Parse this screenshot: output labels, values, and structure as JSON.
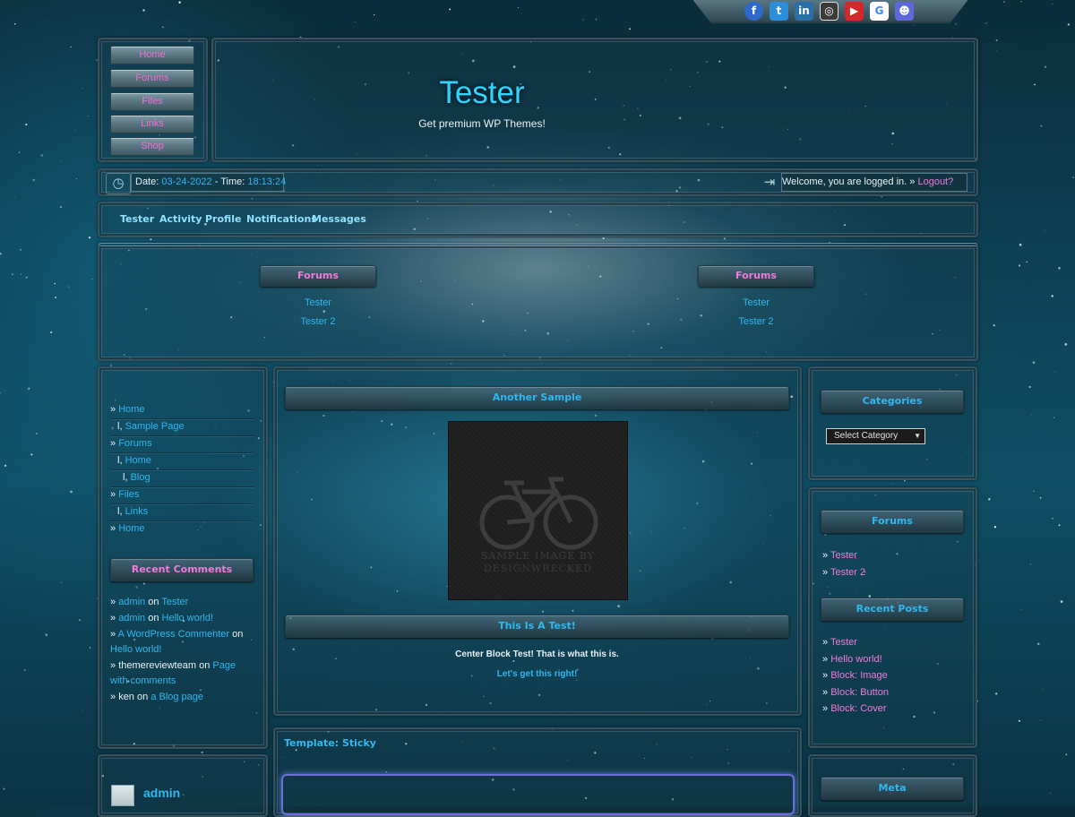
{
  "site": {
    "title": "Tester",
    "tagline": "Get premium WP Themes!"
  },
  "social_icons": [
    "facebook-icon",
    "twitter-icon",
    "linkedin-icon",
    "instagram-icon",
    "youtube-icon",
    "google-icon",
    "discord-icon"
  ],
  "side_nav": [
    "Home",
    "Forums",
    "Files",
    "Links",
    "Shop"
  ],
  "info_bar": {
    "date_label": "Date:",
    "date": "03-24-2022",
    "sep": "-",
    "time_label": "Time:",
    "time": "18:13:24",
    "welcome": "Welcome, you are logged in.",
    "arrow": "»",
    "logout": "Logout?"
  },
  "top_nav": [
    "Tester",
    "Activity",
    "Profile",
    "Notifications",
    "Messages"
  ],
  "forums_blocks": [
    {
      "title": "Forums",
      "items": [
        "Tester",
        "Tester 2"
      ]
    },
    {
      "title": "Forums",
      "items": [
        "Tester",
        "Tester 2"
      ]
    }
  ],
  "left_menu": [
    {
      "prefix": "»",
      "text": "Home"
    },
    {
      "prefix": "l,",
      "text": "Sample Page"
    },
    {
      "prefix": "»",
      "text": "Forums"
    },
    {
      "prefix": "l,",
      "text": "Home"
    },
    {
      "prefix": "l,",
      "text": "Blog"
    },
    {
      "prefix": "»",
      "text": "Files"
    },
    {
      "prefix": "l,",
      "text": "Links"
    },
    {
      "prefix": "»",
      "text": "Home"
    }
  ],
  "recent_comments": {
    "title": "Recent Comments",
    "items": [
      {
        "author": "admin",
        "on": "on",
        "post": "Tester"
      },
      {
        "author": "admin",
        "on": "on",
        "post": "Hello world!"
      },
      {
        "author": "A WordPress Commenter",
        "on": "on",
        "post": "Hello world!"
      },
      {
        "author": "themereviewteam",
        "on": "on",
        "post": "Page with comments"
      },
      {
        "author": "ken",
        "on": "on",
        "post": "a Blog page"
      }
    ]
  },
  "user_box": {
    "name": "admin"
  },
  "center": {
    "block1_title": "Another Sample",
    "image_caption_line1": "SAMPLE IMAGE BY",
    "image_caption_line2": "DESIGNWRECKED",
    "block2_title": "This Is A Test!",
    "block2_text": "Center Block Test! That is what this is.",
    "block2_link": "Let's get this right!",
    "sticky_title": "Template: Sticky"
  },
  "right": {
    "categories_title": "Categories",
    "select_placeholder": "Select Category",
    "forums_title": "Forums",
    "forums_items": [
      "Tester",
      "Tester 2"
    ],
    "recent_posts_title": "Recent Posts",
    "recent_posts": [
      "Tester",
      "Hello world!",
      "Block: Image",
      "Block: Button",
      "Block: Cover"
    ],
    "meta_title": "Meta"
  },
  "colors": {
    "accent_pink": "#f07ad8",
    "accent_blue": "#2fb7f0",
    "title_cyan": "#2fd4ff"
  }
}
